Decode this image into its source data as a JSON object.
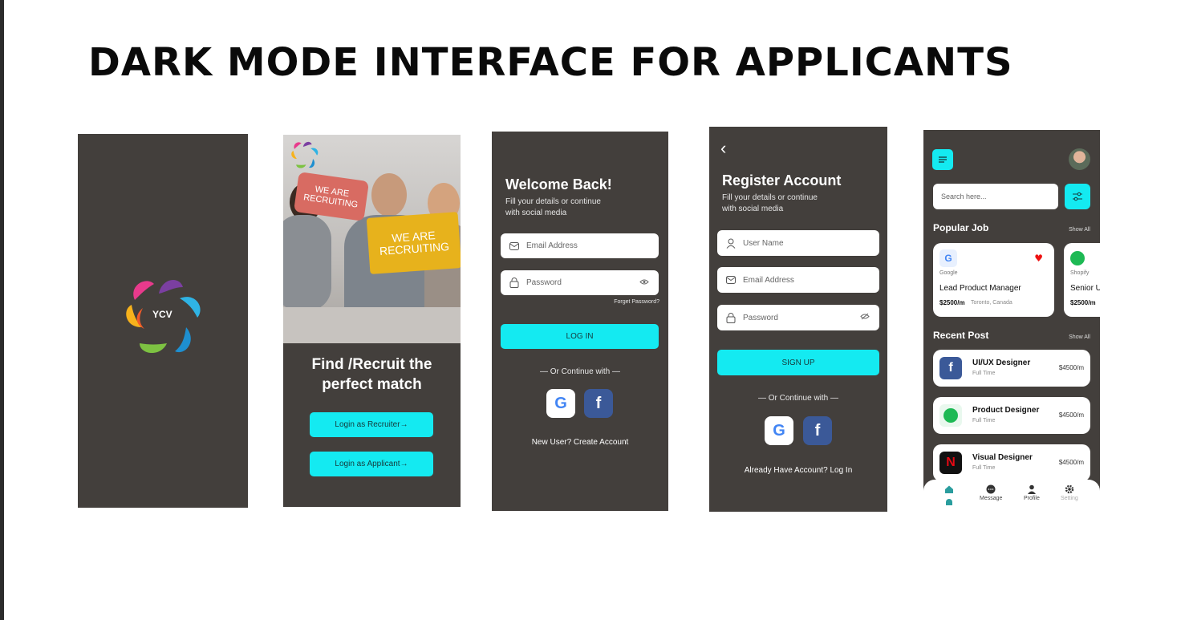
{
  "slide": {
    "title": "DARK MODE INTERFACE FOR APPLICANTS"
  },
  "colors": {
    "screen_bg": "#433f3c",
    "accent": "#14eaf1",
    "facebook": "#3b5998"
  },
  "splash": {
    "logo_text": "YCV"
  },
  "onboarding": {
    "sign_left": "WE ARE RECRUITING",
    "sign_right": "WE ARE RECRUITING",
    "headline_line1": "Find /Recruit the",
    "headline_line2": "perfect match",
    "recruiter_btn": "Login as Recruiter→",
    "applicant_btn": "Login as Applicant→"
  },
  "login": {
    "title": "Welcome Back!",
    "subtitle_line1": "Fill your details or continue",
    "subtitle_line2": "with social media",
    "email_placeholder": "Email Address",
    "password_placeholder": "Password",
    "forgot": "Forget Password?",
    "login_btn": "LOG IN",
    "or_continue": "—  Or Continue with  —",
    "google": "G",
    "facebook": "f",
    "new_user": "New User? Create Account"
  },
  "register": {
    "back": "‹",
    "title": "Register Account",
    "subtitle_line1": "Fill your details or continue",
    "subtitle_line2": "with social media",
    "username_placeholder": "User Name",
    "email_placeholder": "Email Address",
    "password_placeholder": "Password",
    "signup_btn": "SIGN UP",
    "or_continue": "—  Or Continue with  —",
    "google": "G",
    "facebook": "f",
    "have_account": "Already Have Account? Log In"
  },
  "home": {
    "search_placeholder": "Search here...",
    "popular_title": "Popular Job",
    "show_all_1": "Show All",
    "popular_jobs": [
      {
        "company": "Google",
        "title": "Lead Product Manager",
        "salary": "$2500/m",
        "location": "Toronto, Canada"
      },
      {
        "company": "Shopify",
        "title": "Senior U",
        "salary": "$2500/m"
      }
    ],
    "recent_title": "Recent Post",
    "show_all_2": "Show All",
    "recent_posts": [
      {
        "title": "UI/UX Designer",
        "type": "Full Time",
        "salary": "$4500/m",
        "logo": "f",
        "logo_color": "#3b5998"
      },
      {
        "title": "Product Designer",
        "type": "Full Time",
        "salary": "$4500/m",
        "logo": "≡",
        "logo_color": "#1db954"
      },
      {
        "title": "Visual Designer",
        "type": "Full Time",
        "salary": "$4500/m",
        "logo": "N",
        "logo_color": "#111111"
      }
    ],
    "nav": {
      "message": "Message",
      "profile": "Profile",
      "setting": "Setting"
    }
  }
}
